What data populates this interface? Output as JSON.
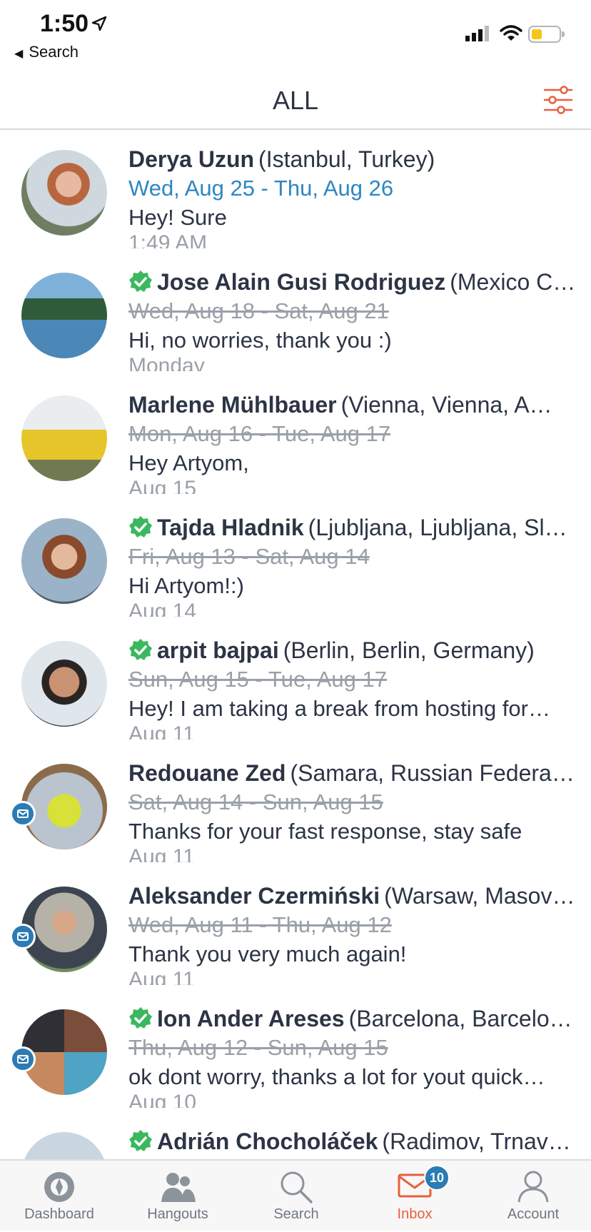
{
  "status": {
    "time": "1:50",
    "back_label": "Search"
  },
  "header": {
    "title": "ALL"
  },
  "colors": {
    "accent": "#e8603c",
    "date_active": "#2e86c1",
    "verified": "#3bb85f",
    "mail_badge": "#2b7bb5"
  },
  "conversations": [
    {
      "name": "Derya Uzun",
      "location": "(Istanbul, Turkey)",
      "dates": "Wed, Aug 25 - Thu, Aug 26",
      "message": "Hey! Sure",
      "time": "1:49 AM"
    },
    {
      "name": "Jose Alain Gusi Rodriguez",
      "location": "(Mexico Ci…",
      "dates": "Wed, Aug 18 - Sat, Aug 21",
      "message": "Hi, no worries, thank you :)",
      "time": "Monday"
    },
    {
      "name": "Marlene  Mühlbauer",
      "location": "(Vienna, Vienna, A…",
      "dates": "Mon, Aug 16 - Tue, Aug 17",
      "message": "Hey Artyom,",
      "time": "Aug 15"
    },
    {
      "name": "Tajda Hladnik",
      "location": "(Ljubljana, Ljubljana, Sl…",
      "dates": "Fri, Aug 13 - Sat, Aug 14",
      "message": "Hi Artyom!:)",
      "time": "Aug 14"
    },
    {
      "name": "arpit bajpai",
      "location": "(Berlin, Berlin, Germany)",
      "dates": "Sun, Aug 15 - Tue, Aug 17",
      "message": "Hey! I am taking a break from hosting for…",
      "time": "Aug 11"
    },
    {
      "name": "Redouane Zed",
      "location": "(Samara, Russian Federat…",
      "dates": "Sat, Aug 14 - Sun, Aug 15",
      "message": "Thanks for your fast response, stay safe",
      "time": "Aug 11"
    },
    {
      "name": "Aleksander Czermiński",
      "location": "(Warsaw, Masov…",
      "dates": "Wed, Aug 11 - Thu, Aug 12",
      "message": "Thank you very much again!",
      "time": "Aug 11"
    },
    {
      "name": "Ion Ander Areses",
      "location": "(Barcelona, Barcelo…",
      "dates": "Thu, Aug 12 - Sun, Aug 15",
      "message": "ok dont worry, thanks a lot for yout quick…",
      "time": "Aug 10"
    },
    {
      "name": "Adrián Chocholáček",
      "location": "(Radimov, Trnav…",
      "dates": "",
      "message": "",
      "time": ""
    }
  ],
  "tabs": [
    {
      "label": "Dashboard",
      "icon": "compass-icon"
    },
    {
      "label": "Hangouts",
      "icon": "people-icon"
    },
    {
      "label": "Search",
      "icon": "search-icon"
    },
    {
      "label": "Inbox",
      "icon": "mail-icon",
      "badge": "10",
      "active": true
    },
    {
      "label": "Account",
      "icon": "person-icon"
    }
  ]
}
